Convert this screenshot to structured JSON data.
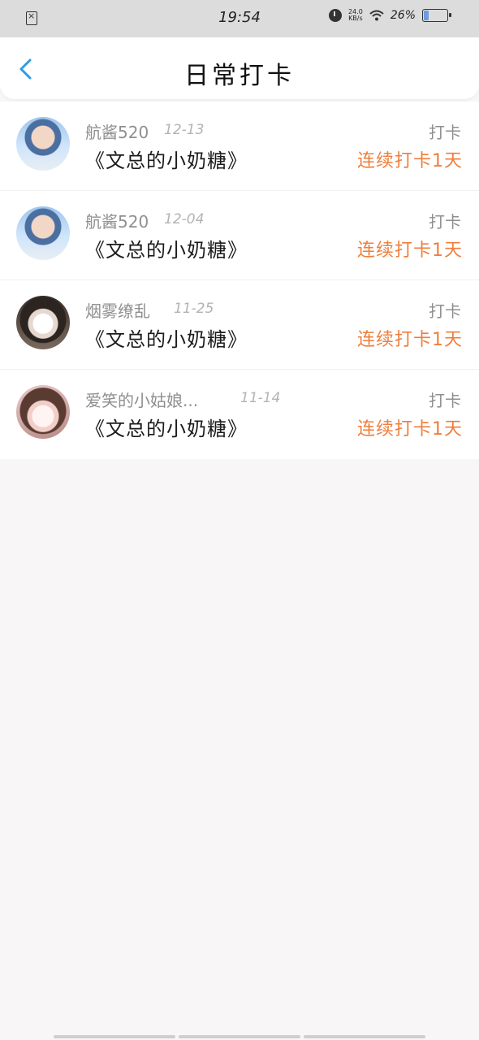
{
  "status_bar": {
    "time": "19:54",
    "net_speed_value": "24.0",
    "net_speed_unit": "KB/s",
    "battery": "26%"
  },
  "header": {
    "title": "日常打卡",
    "back_icon": "chevron-left-icon",
    "accent_color": "#2f9be6"
  },
  "records": [
    {
      "name": "航酱520",
      "date": "12-13",
      "title": "《文总的小奶糖》",
      "action": "打卡",
      "streak": "连续打卡1天"
    },
    {
      "name": "航酱520",
      "date": "12-04",
      "title": "《文总的小奶糖》",
      "action": "打卡",
      "streak": "连续打卡1天"
    },
    {
      "name": "烟雾缭乱",
      "date": "11-25",
      "title": "《文总的小奶糖》",
      "action": "打卡",
      "streak": "连续打卡1天"
    },
    {
      "name": "爱笑的小姑娘...",
      "date": "11-14",
      "title": "《文总的小奶糖》",
      "action": "打卡",
      "streak": "连续打卡1天"
    }
  ],
  "colors": {
    "streak": "#ef7e3c",
    "background": "#f8f6f7"
  }
}
